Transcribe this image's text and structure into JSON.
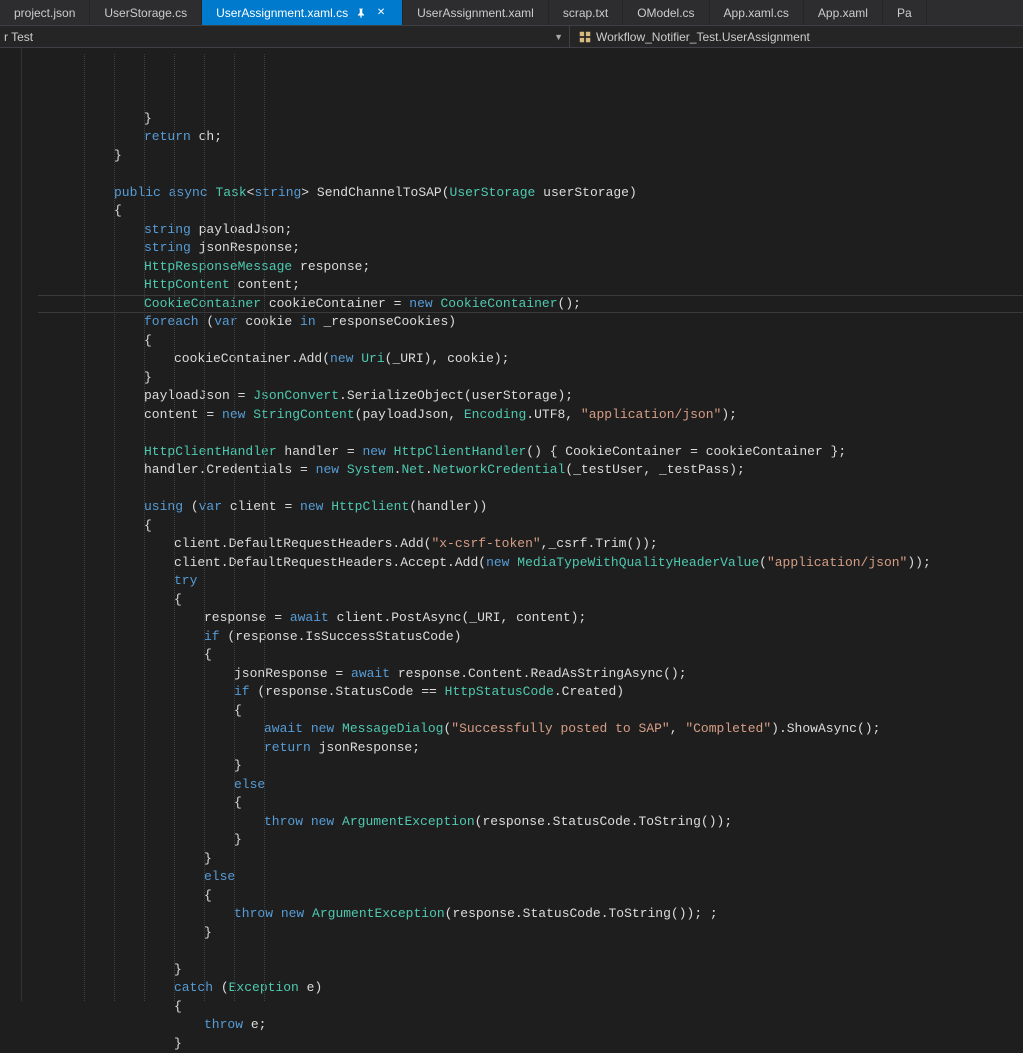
{
  "tabs": [
    {
      "label": "project.json",
      "active": false
    },
    {
      "label": "UserStorage.cs",
      "active": false
    },
    {
      "label": "UserAssignment.xaml.cs",
      "active": true
    },
    {
      "label": "UserAssignment.xaml",
      "active": false
    },
    {
      "label": "scrap.txt",
      "active": false
    },
    {
      "label": "OModel.cs",
      "active": false
    },
    {
      "label": "App.xaml.cs",
      "active": false
    },
    {
      "label": "App.xaml",
      "active": false
    },
    {
      "label": "Pa",
      "active": false
    }
  ],
  "nav": {
    "left": "r Test",
    "right": "Workflow_Notifier_Test.UserAssignment"
  },
  "code": [
    {
      "i": 3,
      "t": [
        [
          "punct",
          "}"
        ]
      ]
    },
    {
      "i": 3,
      "t": [
        [
          "kw",
          "return"
        ],
        [
          "ident",
          " ch"
        ],
        [
          "punct",
          ";"
        ]
      ]
    },
    {
      "i": 2,
      "t": [
        [
          "punct",
          "}"
        ]
      ]
    },
    {
      "i": 0,
      "t": []
    },
    {
      "i": 2,
      "t": [
        [
          "kw",
          "public"
        ],
        [
          "ident",
          " "
        ],
        [
          "kw",
          "async"
        ],
        [
          "ident",
          " "
        ],
        [
          "type",
          "Task"
        ],
        [
          "punct",
          "<"
        ],
        [
          "kw",
          "string"
        ],
        [
          "punct",
          "> "
        ],
        [
          "ident",
          "SendChannelToSAP("
        ],
        [
          "type",
          "UserStorage"
        ],
        [
          "ident",
          " userStorage)"
        ]
      ]
    },
    {
      "i": 2,
      "t": [
        [
          "punct",
          "{"
        ]
      ]
    },
    {
      "i": 3,
      "t": [
        [
          "kw",
          "string"
        ],
        [
          "ident",
          " payloadJson"
        ],
        [
          "punct",
          ";"
        ]
      ]
    },
    {
      "i": 3,
      "t": [
        [
          "kw",
          "string"
        ],
        [
          "ident",
          " jsonResponse"
        ],
        [
          "punct",
          ";"
        ]
      ]
    },
    {
      "i": 3,
      "t": [
        [
          "type",
          "HttpResponseMessage"
        ],
        [
          "ident",
          " response"
        ],
        [
          "punct",
          ";"
        ]
      ]
    },
    {
      "i": 3,
      "t": [
        [
          "type",
          "HttpContent"
        ],
        [
          "ident",
          " content"
        ],
        [
          "punct",
          ";"
        ]
      ]
    },
    {
      "i": 3,
      "t": [
        [
          "type",
          "CookieContainer"
        ],
        [
          "ident",
          " cookieContainer = "
        ],
        [
          "kw",
          "new"
        ],
        [
          "ident",
          " "
        ],
        [
          "type",
          "CookieContainer"
        ],
        [
          "punct",
          "();"
        ]
      ]
    },
    {
      "i": 3,
      "t": [
        [
          "kw",
          "foreach"
        ],
        [
          "ident",
          " ("
        ],
        [
          "kw",
          "var"
        ],
        [
          "ident",
          " cookie "
        ],
        [
          "kw",
          "in"
        ],
        [
          "ident",
          " _responseCookies)"
        ]
      ]
    },
    {
      "i": 3,
      "t": [
        [
          "punct",
          "{"
        ]
      ]
    },
    {
      "i": 4,
      "t": [
        [
          "ident",
          "cookieContainer.Add("
        ],
        [
          "kw",
          "new"
        ],
        [
          "ident",
          " "
        ],
        [
          "type",
          "Uri"
        ],
        [
          "ident",
          "(_URI), cookie);"
        ]
      ]
    },
    {
      "i": 3,
      "t": [
        [
          "punct",
          "}"
        ]
      ]
    },
    {
      "i": 3,
      "t": [
        [
          "ident",
          "payloadJson = "
        ],
        [
          "type",
          "JsonConvert"
        ],
        [
          "ident",
          ".SerializeObject(userStorage);"
        ]
      ]
    },
    {
      "i": 3,
      "t": [
        [
          "ident",
          "content = "
        ],
        [
          "kw",
          "new"
        ],
        [
          "ident",
          " "
        ],
        [
          "type",
          "StringContent"
        ],
        [
          "ident",
          "(payloadJson, "
        ],
        [
          "type",
          "Encoding"
        ],
        [
          "ident",
          ".UTF8, "
        ],
        [
          "str",
          "\"application/json\""
        ],
        [
          "punct",
          ");"
        ]
      ]
    },
    {
      "i": 0,
      "t": []
    },
    {
      "i": 3,
      "t": [
        [
          "type",
          "HttpClientHandler"
        ],
        [
          "ident",
          " handler = "
        ],
        [
          "kw",
          "new"
        ],
        [
          "ident",
          " "
        ],
        [
          "type",
          "HttpClientHandler"
        ],
        [
          "ident",
          "() { CookieContainer = cookieContainer };"
        ]
      ]
    },
    {
      "i": 3,
      "t": [
        [
          "ident",
          "handler.Credentials = "
        ],
        [
          "kw",
          "new"
        ],
        [
          "ident",
          " "
        ],
        [
          "type",
          "System"
        ],
        [
          "ident",
          "."
        ],
        [
          "type",
          "Net"
        ],
        [
          "ident",
          "."
        ],
        [
          "type",
          "NetworkCredential"
        ],
        [
          "ident",
          "(_testUser, _testPass);"
        ]
      ]
    },
    {
      "i": 0,
      "t": []
    },
    {
      "i": 3,
      "t": [
        [
          "kw",
          "using"
        ],
        [
          "ident",
          " ("
        ],
        [
          "kw",
          "var"
        ],
        [
          "ident",
          " client = "
        ],
        [
          "kw",
          "new"
        ],
        [
          "ident",
          " "
        ],
        [
          "type",
          "HttpClient"
        ],
        [
          "ident",
          "(handler))"
        ]
      ]
    },
    {
      "i": 3,
      "t": [
        [
          "punct",
          "{"
        ]
      ]
    },
    {
      "i": 4,
      "t": [
        [
          "ident",
          "client.DefaultRequestHeaders.Add("
        ],
        [
          "str",
          "\"x-csrf-token\""
        ],
        [
          "ident",
          ",_csrf.Trim());"
        ]
      ]
    },
    {
      "i": 4,
      "t": [
        [
          "ident",
          "client.DefaultRequestHeaders.Accept.Add("
        ],
        [
          "kw",
          "new"
        ],
        [
          "ident",
          " "
        ],
        [
          "type",
          "MediaTypeWithQualityHeaderValue"
        ],
        [
          "ident",
          "("
        ],
        [
          "str",
          "\"application/json\""
        ],
        [
          "ident",
          "));"
        ]
      ]
    },
    {
      "i": 4,
      "t": [
        [
          "kw",
          "try"
        ]
      ]
    },
    {
      "i": 4,
      "t": [
        [
          "punct",
          "{"
        ]
      ]
    },
    {
      "i": 5,
      "t": [
        [
          "ident",
          "response = "
        ],
        [
          "kw",
          "await"
        ],
        [
          "ident",
          " client.PostAsync(_URI, content);"
        ]
      ]
    },
    {
      "i": 5,
      "t": [
        [
          "kw",
          "if"
        ],
        [
          "ident",
          " (response.IsSuccessStatusCode)"
        ]
      ]
    },
    {
      "i": 5,
      "t": [
        [
          "punct",
          "{"
        ]
      ]
    },
    {
      "i": 6,
      "t": [
        [
          "ident",
          "jsonResponse = "
        ],
        [
          "kw",
          "await"
        ],
        [
          "ident",
          " response.Content.ReadAsStringAsync();"
        ]
      ]
    },
    {
      "i": 6,
      "t": [
        [
          "kw",
          "if"
        ],
        [
          "ident",
          " (response.StatusCode == "
        ],
        [
          "type",
          "HttpStatusCode"
        ],
        [
          "ident",
          ".Created)"
        ]
      ]
    },
    {
      "i": 6,
      "t": [
        [
          "punct",
          "{"
        ]
      ]
    },
    {
      "i": 7,
      "t": [
        [
          "kw",
          "await"
        ],
        [
          "ident",
          " "
        ],
        [
          "kw",
          "new"
        ],
        [
          "ident",
          " "
        ],
        [
          "type",
          "MessageDialog"
        ],
        [
          "ident",
          "("
        ],
        [
          "str",
          "\"Successfully posted to SAP\""
        ],
        [
          "ident",
          ", "
        ],
        [
          "str",
          "\"Completed\""
        ],
        [
          "ident",
          ").ShowAsync();"
        ]
      ]
    },
    {
      "i": 7,
      "t": [
        [
          "kw",
          "return"
        ],
        [
          "ident",
          " jsonResponse;"
        ]
      ]
    },
    {
      "i": 6,
      "t": [
        [
          "punct",
          "}"
        ]
      ]
    },
    {
      "i": 6,
      "t": [
        [
          "kw",
          "else"
        ]
      ]
    },
    {
      "i": 6,
      "t": [
        [
          "punct",
          "{"
        ]
      ]
    },
    {
      "i": 7,
      "t": [
        [
          "kw",
          "throw"
        ],
        [
          "ident",
          " "
        ],
        [
          "kw",
          "new"
        ],
        [
          "ident",
          " "
        ],
        [
          "type",
          "ArgumentException"
        ],
        [
          "ident",
          "(response.StatusCode.ToString());"
        ]
      ]
    },
    {
      "i": 6,
      "t": [
        [
          "punct",
          "}"
        ]
      ]
    },
    {
      "i": 5,
      "t": [
        [
          "punct",
          "}"
        ]
      ]
    },
    {
      "i": 5,
      "t": [
        [
          "kw",
          "else"
        ]
      ]
    },
    {
      "i": 5,
      "t": [
        [
          "punct",
          "{"
        ]
      ]
    },
    {
      "i": 6,
      "t": [
        [
          "kw",
          "throw"
        ],
        [
          "ident",
          " "
        ],
        [
          "kw",
          "new"
        ],
        [
          "ident",
          " "
        ],
        [
          "type",
          "ArgumentException"
        ],
        [
          "ident",
          "(response.StatusCode.ToString()); ;"
        ]
      ]
    },
    {
      "i": 5,
      "t": [
        [
          "punct",
          "}"
        ]
      ]
    },
    {
      "i": 0,
      "t": []
    },
    {
      "i": 4,
      "t": [
        [
          "punct",
          "}"
        ]
      ]
    },
    {
      "i": 4,
      "t": [
        [
          "kw",
          "catch"
        ],
        [
          "ident",
          " ("
        ],
        [
          "type",
          "Exception"
        ],
        [
          "ident",
          " e)"
        ]
      ]
    },
    {
      "i": 4,
      "t": [
        [
          "punct",
          "{"
        ]
      ]
    },
    {
      "i": 5,
      "t": [
        [
          "kw",
          "throw"
        ],
        [
          "ident",
          " e;"
        ]
      ]
    },
    {
      "i": 4,
      "t": [
        [
          "punct",
          "}"
        ]
      ]
    }
  ],
  "current_line_index": 13
}
